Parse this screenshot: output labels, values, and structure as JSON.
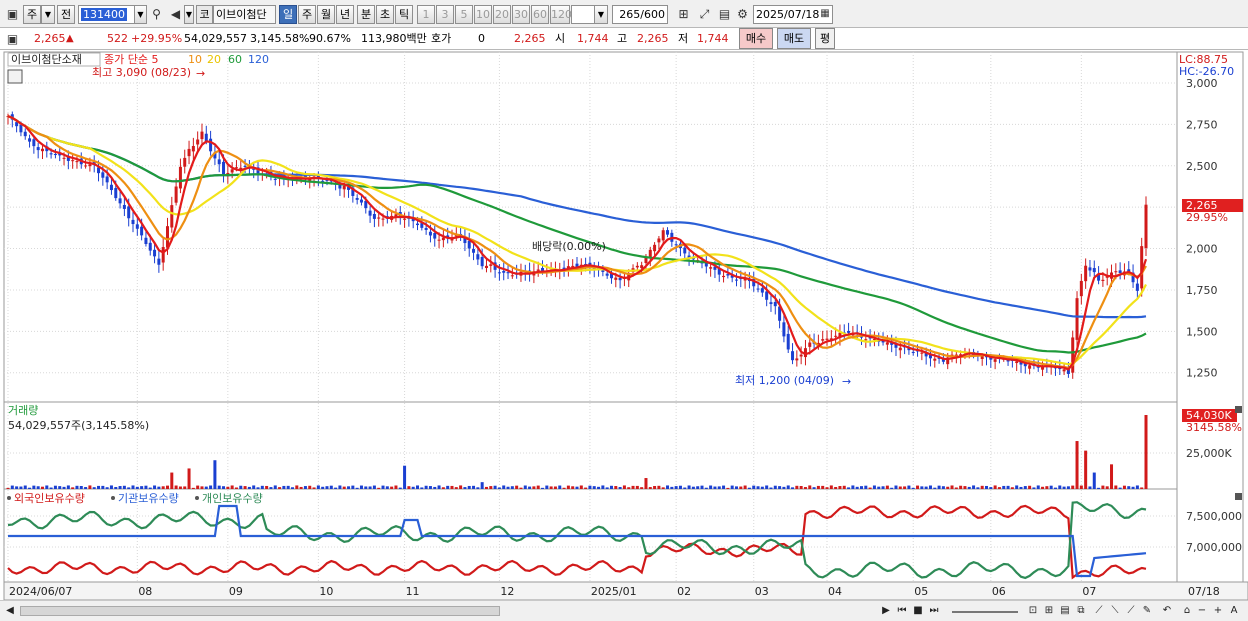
{
  "toolbar": {
    "period_type": "주",
    "market": "전",
    "code": "131400",
    "stock_name_short": "이브이첨단",
    "stock_badge": "코",
    "periods": [
      "일",
      "주",
      "월",
      "년",
      "분",
      "초",
      "틱"
    ],
    "selected_period": "일",
    "intervals": [
      "1",
      "3",
      "5",
      "10",
      "20",
      "30",
      "60",
      "120"
    ],
    "count": "265",
    "count_total": "/600",
    "date": "2025/07/18"
  },
  "quote": {
    "price": "2,265",
    "change": "522",
    "change_pct": "+29.95%",
    "volume": "54,029,557",
    "volume_pct": "3,145.58%",
    "turnover_pct": "90.67%",
    "amount": "113,980백만",
    "hoga_label": "호가",
    "hoga_value": "0",
    "last": "2,265",
    "open_label": "시",
    "open": "1,744",
    "high_label": "고",
    "high": "2,265",
    "low_label": "저",
    "low": "1,744",
    "buy_label": "매수",
    "sell_label": "매도",
    "eval_label": "평"
  },
  "colors": {
    "up": "#d11a1a",
    "down": "#1a3fd1",
    "ma5": "#e31b1b",
    "ma10": "#ee8f12",
    "ma20": "#f2e21a",
    "ma60": "#1f9a3a",
    "ma120": "#2a5fd6",
    "bg": "#ffffff",
    "grid": "#d8d8d8"
  },
  "icons": [
    "search-icon",
    "speaker-icon",
    "layout-icon",
    "chart-icon",
    "save-icon",
    "gear-icon",
    "calendar-icon",
    "home-icon",
    "ruler-icon",
    "zoom-in-icon",
    "zoom-out-icon"
  ],
  "chart_data": [
    {
      "type": "candlestick",
      "title": "이브이첨단소재",
      "legend": [
        {
          "name": "종가 단순",
          "period": "5",
          "color": "#e31b1b"
        },
        {
          "name": "",
          "period": "10",
          "color": "#ee8f12"
        },
        {
          "name": "",
          "period": "20",
          "color": "#e8c400"
        },
        {
          "name": "",
          "period": "60",
          "color": "#1f9a3a"
        },
        {
          "name": "",
          "period": "120",
          "color": "#2a5fd6"
        }
      ],
      "y_ticks": [
        "3,000",
        "2,750",
        "2,500",
        "2,250",
        "2,000",
        "1,750",
        "1,500",
        "1,250"
      ],
      "ylim": [
        1050,
        3150
      ],
      "lc_label": "LC:88.75",
      "hc_label": "HC:-26.70",
      "last_price_label": "2,265",
      "last_pct_label": "29.95%",
      "annotations": {
        "high": "최고 3,090 (08/23)",
        "low": "최저 1,200 (04/09)",
        "dividend": "배당락(0.00%)"
      },
      "x_ticks": [
        "2024/06/07",
        "08",
        "09",
        "10",
        "11",
        "12",
        "2025/01",
        "02",
        "03",
        "04",
        "05",
        "06",
        "07",
        "07/18"
      ],
      "close_anchors": [
        [
          0,
          2800
        ],
        [
          5,
          2640
        ],
        [
          12,
          2550
        ],
        [
          20,
          2500
        ],
        [
          28,
          2200
        ],
        [
          35,
          1900
        ],
        [
          40,
          2500
        ],
        [
          45,
          2700
        ],
        [
          50,
          2450
        ],
        [
          55,
          2500
        ],
        [
          62,
          2420
        ],
        [
          70,
          2430
        ],
        [
          78,
          2380
        ],
        [
          85,
          2180
        ],
        [
          90,
          2200
        ],
        [
          95,
          2150
        ],
        [
          100,
          2050
        ],
        [
          105,
          2080
        ],
        [
          110,
          1900
        ],
        [
          115,
          1850
        ],
        [
          120,
          1850
        ],
        [
          128,
          1880
        ],
        [
          135,
          1900
        ],
        [
          142,
          1800
        ],
        [
          148,
          1950
        ],
        [
          152,
          2100
        ],
        [
          158,
          1950
        ],
        [
          165,
          1850
        ],
        [
          172,
          1800
        ],
        [
          178,
          1650
        ],
        [
          182,
          1300
        ],
        [
          186,
          1430
        ],
        [
          190,
          1450
        ],
        [
          195,
          1500
        ],
        [
          200,
          1450
        ],
        [
          208,
          1400
        ],
        [
          215,
          1330
        ],
        [
          222,
          1370
        ],
        [
          230,
          1330
        ],
        [
          238,
          1290
        ],
        [
          243,
          1280
        ],
        [
          246,
          1250
        ],
        [
          248,
          1700
        ],
        [
          250,
          1900
        ],
        [
          253,
          1800
        ],
        [
          257,
          1870
        ],
        [
          260,
          1850
        ],
        [
          262,
          1744
        ],
        [
          264,
          2265
        ]
      ],
      "ma_end_values": {
        "ma5": 1850,
        "ma10": 1750,
        "ma20": 1600,
        "ma60": 1470,
        "ma120": 1620
      }
    },
    {
      "type": "bar",
      "title": "거래량",
      "summary": "54,029,557주(3,145.58%)",
      "y_ticks": [
        "25,000K"
      ],
      "last_label": "54,030K",
      "last_pct_label": "3145.58%",
      "spikes": [
        [
          38,
          12
        ],
        [
          42,
          15
        ],
        [
          48,
          21
        ],
        [
          92,
          17
        ],
        [
          110,
          5
        ],
        [
          148,
          8
        ],
        [
          248,
          35
        ],
        [
          250,
          28
        ],
        [
          252,
          12
        ],
        [
          256,
          18
        ],
        [
          264,
          54
        ]
      ]
    },
    {
      "type": "line",
      "series": [
        {
          "name": "외국인보유수량",
          "color": "#d11a1a"
        },
        {
          "name": "기관보유수량",
          "color": "#2a5fd6"
        },
        {
          "name": "개인보유수량",
          "color": "#2e8b57"
        }
      ],
      "y_ticks": [
        "7,500,000",
        "7,000,000"
      ]
    }
  ],
  "scroll": {
    "left_arrow": "◀",
    "right_arrow": "▶"
  }
}
